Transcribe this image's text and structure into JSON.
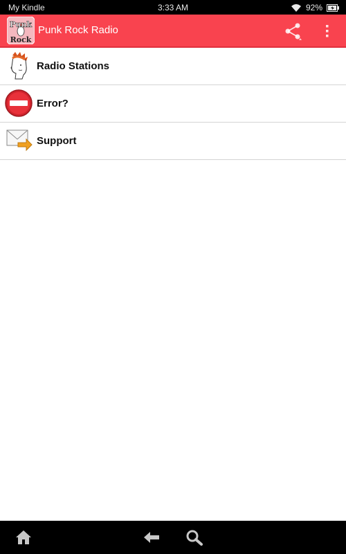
{
  "status_bar": {
    "carrier": "My Kindle",
    "time": "3:33 AM",
    "battery": "92%",
    "icons": [
      "wifi-icon",
      "battery-icon"
    ]
  },
  "action_bar": {
    "title": "Punk Rock Radio",
    "app_icon_text": [
      "Punk",
      "Rock"
    ],
    "background_color": "#f9434f",
    "actions": [
      "share-icon",
      "overflow-menu-icon"
    ]
  },
  "menu": {
    "items": [
      {
        "label": "Radio Stations",
        "icon": "mohawk-punk-icon"
      },
      {
        "label": "Error?",
        "icon": "no-entry-icon"
      },
      {
        "label": "Support",
        "icon": "envelope-forward-icon"
      }
    ]
  },
  "nav_bar": {
    "buttons": [
      "home-icon",
      "back-icon",
      "search-icon"
    ]
  }
}
